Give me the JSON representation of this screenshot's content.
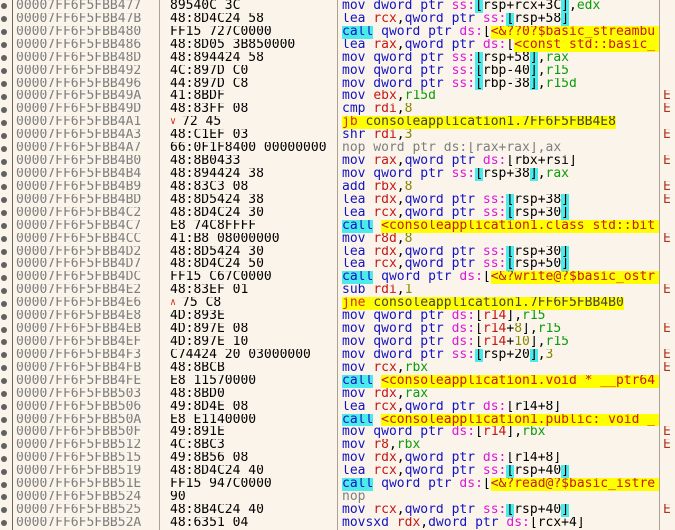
{
  "comment_char": "E",
  "icons": {
    "down": "∨",
    "up": "∧"
  },
  "colors": {
    "background": "#FBF4EA",
    "highlight_yellow": "#FFFF00",
    "call_cyan": "#4CEBEB",
    "mnemonic_blue": "#1313C2",
    "register_red": "#C51717",
    "source_register_green": "#0B9C0B",
    "immediate_olive": "#878700",
    "segment_magenta": "#DD16DD",
    "address_gray": "#7E7E7E",
    "comment_red": "#B0351E"
  },
  "rows": [
    {
      "a": "00007FF6F5FBB477",
      "b": "89540C 3C",
      "t": [
        [
          "m",
          "mov dword ptr "
        ],
        [
          "s",
          "ss:"
        ],
        [
          "k",
          "["
        ],
        [
          "p",
          "rsp+rcx+3C"
        ],
        [
          "k",
          "]"
        ],
        [
          "p",
          ","
        ],
        [
          "g",
          "edx"
        ]
      ]
    },
    {
      "a": "00007FF6F5FBB47B",
      "b": "48:8D4C24 58",
      "t": [
        [
          "m",
          "lea "
        ],
        [
          "r",
          "rcx"
        ],
        [
          "p",
          ","
        ],
        [
          "m",
          "qword ptr "
        ],
        [
          "s",
          "ss:"
        ],
        [
          "k",
          "["
        ],
        [
          "p",
          "rsp+58"
        ],
        [
          "k",
          "]"
        ]
      ]
    },
    {
      "a": "00007FF6F5FBB480",
      "b": "FF15 727C0000",
      "t": [
        [
          "cm",
          "call"
        ],
        [
          "p",
          " "
        ],
        [
          "m",
          "qword ptr "
        ],
        [
          "s",
          "ds:"
        ],
        [
          "p",
          "["
        ],
        [
          "yr",
          "<&??0?$basic_streambu"
        ]
      ],
      "fill": true
    },
    {
      "a": "00007FF6F5FBB486",
      "b": "48:8D05 3B850000",
      "t": [
        [
          "m",
          "lea "
        ],
        [
          "r",
          "rax"
        ],
        [
          "p",
          ","
        ],
        [
          "m",
          "qword ptr "
        ],
        [
          "s",
          "ds:"
        ],
        [
          "p",
          "["
        ],
        [
          "yr",
          "<const std::basic_"
        ]
      ],
      "fill": true
    },
    {
      "a": "00007FF6F5FBB48D",
      "b": "48:894424 58",
      "t": [
        [
          "m",
          "mov qword ptr "
        ],
        [
          "s",
          "ss:"
        ],
        [
          "k",
          "["
        ],
        [
          "p",
          "rsp+58"
        ],
        [
          "k",
          "]"
        ],
        [
          "p",
          ","
        ],
        [
          "g",
          "rax"
        ]
      ]
    },
    {
      "a": "00007FF6F5FBB492",
      "b": "4C:897D C0",
      "t": [
        [
          "m",
          "mov qword ptr "
        ],
        [
          "s",
          "ss:"
        ],
        [
          "k",
          "["
        ],
        [
          "p",
          "rbp-40"
        ],
        [
          "k",
          "]"
        ],
        [
          "p",
          ","
        ],
        [
          "g",
          "r15"
        ]
      ]
    },
    {
      "a": "00007FF6F5FBB496",
      "b": "44:897D C8",
      "t": [
        [
          "m",
          "mov dword ptr "
        ],
        [
          "s",
          "ss:"
        ],
        [
          "k",
          "["
        ],
        [
          "p",
          "rbp-38"
        ],
        [
          "k",
          "]"
        ],
        [
          "p",
          ","
        ],
        [
          "g",
          "r15d"
        ]
      ]
    },
    {
      "a": "00007FF6F5FBB49A",
      "b": "41:8BDF",
      "t": [
        [
          "m",
          "mov "
        ],
        [
          "r",
          "ebx"
        ],
        [
          "p",
          ","
        ],
        [
          "g",
          "r15d"
        ]
      ],
      "e": true
    },
    {
      "a": "00007FF6F5FBB49D",
      "b": "48:83FF 08",
      "t": [
        [
          "m",
          "cmp "
        ],
        [
          "r",
          "rdi"
        ],
        [
          "p",
          ","
        ],
        [
          "n",
          "8"
        ]
      ],
      "e": true
    },
    {
      "a": "00007FF6F5FBB4A1",
      "b": "72 45",
      "arrow": "down",
      "t": [
        [
          "j",
          "jb "
        ],
        [
          "jt",
          "consoleapplication1.7FF6F5FBB4E8"
        ]
      ]
    },
    {
      "a": "00007FF6F5FBB4A3",
      "b": "48:C1EF 03",
      "t": [
        [
          "m",
          "shr "
        ],
        [
          "r",
          "rdi"
        ],
        [
          "p",
          ","
        ],
        [
          "n",
          "3"
        ]
      ],
      "e": true
    },
    {
      "a": "00007FF6F5FBB4A7",
      "b": "66:0F1F8400 00000000",
      "t": [
        [
          "y",
          "nop word ptr ds:[rax+rax],ax"
        ]
      ]
    },
    {
      "a": "00007FF6F5FBB4B0",
      "b": "48:8B0433",
      "t": [
        [
          "m",
          "mov "
        ],
        [
          "r",
          "rax"
        ],
        [
          "p",
          ","
        ],
        [
          "m",
          "qword ptr "
        ],
        [
          "s",
          "ds:"
        ],
        [
          "p",
          "[rbx+rsi]"
        ]
      ],
      "e": true
    },
    {
      "a": "00007FF6F5FBB4B4",
      "b": "48:894424 38",
      "t": [
        [
          "m",
          "mov qword ptr "
        ],
        [
          "s",
          "ss:"
        ],
        [
          "k",
          "["
        ],
        [
          "p",
          "rsp+38"
        ],
        [
          "k",
          "]"
        ],
        [
          "p",
          ","
        ],
        [
          "g",
          "rax"
        ]
      ]
    },
    {
      "a": "00007FF6F5FBB4B9",
      "b": "48:83C3 08",
      "t": [
        [
          "m",
          "add "
        ],
        [
          "r",
          "rbx"
        ],
        [
          "p",
          ","
        ],
        [
          "n",
          "8"
        ]
      ],
      "e": true
    },
    {
      "a": "00007FF6F5FBB4BD",
      "b": "48:8D5424 38",
      "t": [
        [
          "m",
          "lea "
        ],
        [
          "r",
          "rdx"
        ],
        [
          "p",
          ","
        ],
        [
          "m",
          "qword ptr "
        ],
        [
          "s",
          "ss:"
        ],
        [
          "k",
          "["
        ],
        [
          "p",
          "rsp+38"
        ],
        [
          "k",
          "]"
        ]
      ],
      "e": true
    },
    {
      "a": "00007FF6F5FBB4C2",
      "b": "48:8D4C24 30",
      "t": [
        [
          "m",
          "lea "
        ],
        [
          "r",
          "rcx"
        ],
        [
          "p",
          ","
        ],
        [
          "m",
          "qword ptr "
        ],
        [
          "s",
          "ss:"
        ],
        [
          "k",
          "["
        ],
        [
          "p",
          "rsp+30"
        ],
        [
          "k",
          "]"
        ]
      ]
    },
    {
      "a": "00007FF6F5FBB4C7",
      "b": "E8 74C8FFFF",
      "t": [
        [
          "cm",
          "call"
        ],
        [
          "p",
          " "
        ],
        [
          "yr",
          "<consoleapplication1.class std::bit"
        ]
      ],
      "fill": true
    },
    {
      "a": "00007FF6F5FBB4CC",
      "b": "41:B8 08000000",
      "t": [
        [
          "m",
          "mov "
        ],
        [
          "r",
          "r8d"
        ],
        [
          "p",
          ","
        ],
        [
          "n",
          "8"
        ]
      ],
      "e": true
    },
    {
      "a": "00007FF6F5FBB4D2",
      "b": "48:8D5424 30",
      "t": [
        [
          "m",
          "lea "
        ],
        [
          "r",
          "rdx"
        ],
        [
          "p",
          ","
        ],
        [
          "m",
          "qword ptr "
        ],
        [
          "s",
          "ss:"
        ],
        [
          "k",
          "["
        ],
        [
          "p",
          "rsp+30"
        ],
        [
          "k",
          "]"
        ]
      ]
    },
    {
      "a": "00007FF6F5FBB4D7",
      "b": "48:8D4C24 50",
      "t": [
        [
          "m",
          "lea "
        ],
        [
          "r",
          "rcx"
        ],
        [
          "p",
          ","
        ],
        [
          "m",
          "qword ptr "
        ],
        [
          "s",
          "ss:"
        ],
        [
          "k",
          "["
        ],
        [
          "p",
          "rsp+50"
        ],
        [
          "k",
          "]"
        ]
      ]
    },
    {
      "a": "00007FF6F5FBB4DC",
      "b": "FF15 C67C0000",
      "t": [
        [
          "cm",
          "call"
        ],
        [
          "p",
          " "
        ],
        [
          "m",
          "qword ptr "
        ],
        [
          "s",
          "ds:"
        ],
        [
          "p",
          "["
        ],
        [
          "yr",
          "<&?write@?$basic_ostr"
        ]
      ],
      "fill": true
    },
    {
      "a": "00007FF6F5FBB4E2",
      "b": "48:83EF 01",
      "t": [
        [
          "m",
          "sub "
        ],
        [
          "r",
          "rdi"
        ],
        [
          "p",
          ","
        ],
        [
          "n",
          "1"
        ]
      ],
      "e": true
    },
    {
      "a": "00007FF6F5FBB4E6",
      "b": "75 C8",
      "arrow": "up",
      "t": [
        [
          "j",
          "jne "
        ],
        [
          "jt",
          "consoleapplication1.7FF6F5FBB4B0"
        ]
      ]
    },
    {
      "a": "00007FF6F5FBB4E8",
      "b": "4D:893E",
      "t": [
        [
          "m",
          "mov qword ptr "
        ],
        [
          "s",
          "ds:"
        ],
        [
          "p",
          "["
        ],
        [
          "r",
          "r14"
        ],
        [
          "p",
          "],"
        ],
        [
          "g",
          "r15"
        ]
      ]
    },
    {
      "a": "00007FF6F5FBB4EB",
      "b": "4D:897E 08",
      "t": [
        [
          "m",
          "mov qword ptr "
        ],
        [
          "s",
          "ds:"
        ],
        [
          "p",
          "["
        ],
        [
          "r",
          "r14"
        ],
        [
          "p",
          "+"
        ],
        [
          "n",
          "8"
        ],
        [
          "p",
          "],"
        ],
        [
          "g",
          "r15"
        ]
      ],
      "e": true
    },
    {
      "a": "00007FF6F5FBB4EF",
      "b": "4D:897E 10",
      "t": [
        [
          "m",
          "mov qword ptr "
        ],
        [
          "s",
          "ds:"
        ],
        [
          "p",
          "["
        ],
        [
          "r",
          "r14"
        ],
        [
          "p",
          "+"
        ],
        [
          "n",
          "10"
        ],
        [
          "p",
          "],"
        ],
        [
          "g",
          "r15"
        ]
      ]
    },
    {
      "a": "00007FF6F5FBB4F3",
      "b": "C74424 20 03000000",
      "t": [
        [
          "m",
          "mov dword ptr "
        ],
        [
          "s",
          "ss:"
        ],
        [
          "k",
          "["
        ],
        [
          "p",
          "rsp+20"
        ],
        [
          "k",
          "]"
        ],
        [
          "p",
          ","
        ],
        [
          "n",
          "3"
        ]
      ],
      "e": true
    },
    {
      "a": "00007FF6F5FBB4FB",
      "b": "48:8BCB",
      "t": [
        [
          "m",
          "mov "
        ],
        [
          "r",
          "rcx"
        ],
        [
          "p",
          ","
        ],
        [
          "g",
          "rbx"
        ]
      ],
      "e": true
    },
    {
      "a": "00007FF6F5FBB4FE",
      "b": "E8 11570000",
      "t": [
        [
          "cm",
          "call"
        ],
        [
          "p",
          " "
        ],
        [
          "yr",
          "<consoleapplication1.void * __ptr64"
        ]
      ],
      "fill": true
    },
    {
      "a": "00007FF6F5FBB503",
      "b": "48:8BD0",
      "t": [
        [
          "m",
          "mov "
        ],
        [
          "r",
          "rdx"
        ],
        [
          "p",
          ","
        ],
        [
          "g",
          "rax"
        ]
      ]
    },
    {
      "a": "00007FF6F5FBB506",
      "b": "49:8D4E 08",
      "t": [
        [
          "m",
          "lea "
        ],
        [
          "r",
          "rcx"
        ],
        [
          "p",
          ","
        ],
        [
          "m",
          "qword ptr "
        ],
        [
          "s",
          "ds:"
        ],
        [
          "p",
          "[r14+8]"
        ]
      ]
    },
    {
      "a": "00007FF6F5FBB50A",
      "b": "E8 E1140000",
      "t": [
        [
          "cm",
          "call"
        ],
        [
          "p",
          " "
        ],
        [
          "yr",
          "<consoleapplication1.public: void _"
        ]
      ],
      "fill": true
    },
    {
      "a": "00007FF6F5FBB50F",
      "b": "49:891E",
      "t": [
        [
          "m",
          "mov qword ptr "
        ],
        [
          "s",
          "ds:"
        ],
        [
          "p",
          "["
        ],
        [
          "r",
          "r14"
        ],
        [
          "p",
          "],"
        ],
        [
          "g",
          "rbx"
        ]
      ],
      "e": true
    },
    {
      "a": "00007FF6F5FBB512",
      "b": "4C:8BC3",
      "t": [
        [
          "m",
          "mov "
        ],
        [
          "r",
          "r8"
        ],
        [
          "p",
          ","
        ],
        [
          "g",
          "rbx"
        ]
      ],
      "e": true
    },
    {
      "a": "00007FF6F5FBB515",
      "b": "49:8B56 08",
      "t": [
        [
          "m",
          "mov "
        ],
        [
          "r",
          "rdx"
        ],
        [
          "p",
          ","
        ],
        [
          "m",
          "qword ptr "
        ],
        [
          "s",
          "ds:"
        ],
        [
          "p",
          "[r14+8]"
        ]
      ]
    },
    {
      "a": "00007FF6F5FBB519",
      "b": "48:8D4C24 40",
      "t": [
        [
          "m",
          "lea "
        ],
        [
          "r",
          "rcx"
        ],
        [
          "p",
          ","
        ],
        [
          "m",
          "qword ptr "
        ],
        [
          "s",
          "ss:"
        ],
        [
          "k",
          "["
        ],
        [
          "p",
          "rsp+40"
        ],
        [
          "k",
          "]"
        ]
      ]
    },
    {
      "a": "00007FF6F5FBB51E",
      "b": "FF15 947C0000",
      "t": [
        [
          "cm",
          "call"
        ],
        [
          "p",
          " "
        ],
        [
          "m",
          "qword ptr "
        ],
        [
          "s",
          "ds:"
        ],
        [
          "p",
          "["
        ],
        [
          "yr",
          "<&?read@?$basic_istre"
        ]
      ],
      "fill": true
    },
    {
      "a": "00007FF6F5FBB524",
      "b": "90",
      "t": [
        [
          "y",
          "nop"
        ]
      ]
    },
    {
      "a": "00007FF6F5FBB525",
      "b": "48:8B4C24 40",
      "t": [
        [
          "m",
          "mov "
        ],
        [
          "r",
          "rcx"
        ],
        [
          "p",
          ","
        ],
        [
          "m",
          "qword ptr "
        ],
        [
          "s",
          "ss:"
        ],
        [
          "k",
          "["
        ],
        [
          "p",
          "rsp+40"
        ],
        [
          "k",
          "]"
        ]
      ],
      "e": true
    },
    {
      "a": "00007FF6F5FBB52A",
      "b": "48:6351 04",
      "t": [
        [
          "m",
          "movsxd "
        ],
        [
          "r",
          "rdx"
        ],
        [
          "p",
          ","
        ],
        [
          "m",
          "dword ptr "
        ],
        [
          "s",
          "ds:"
        ],
        [
          "p",
          "[rcx+4]"
        ]
      ]
    }
  ]
}
